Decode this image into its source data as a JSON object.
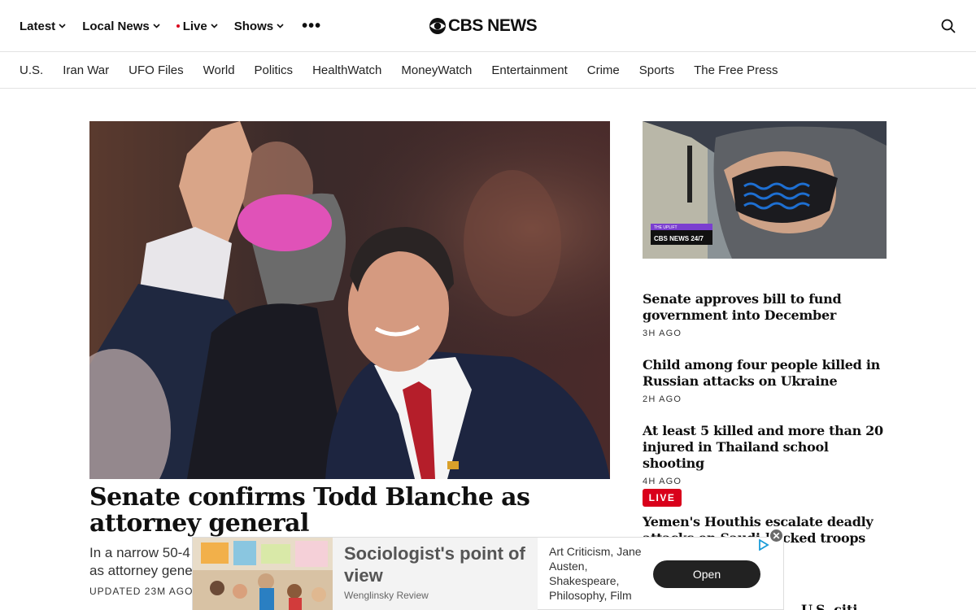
{
  "header": {
    "nav": [
      {
        "label": "Latest"
      },
      {
        "label": "Local News"
      },
      {
        "label": "Live"
      },
      {
        "label": "Shows"
      }
    ],
    "logo_text": "CBS NEWS"
  },
  "sections": [
    "U.S.",
    "Iran War",
    "UFO Files",
    "World",
    "Politics",
    "HealthWatch",
    "MoneyWatch",
    "Entertainment",
    "Crime",
    "Sports",
    "The Free Press"
  ],
  "hero": {
    "title": "Senate confirms Todd Blanche as attorney general",
    "dek_line1": "In a narrow 50-4",
    "dek_line2": "as attorney gene",
    "updated": "UPDATED 23M AGO"
  },
  "rail": {
    "image_badge_top": "THE UPLIFT",
    "image_badge_bottom": "CBS NEWS 24/7",
    "stories": [
      {
        "headline": "Senate approves bill to fund government into December",
        "time": "3H AGO"
      },
      {
        "headline": "Child among four people killed in Russian attacks on Ukraine",
        "time": "2H AGO"
      },
      {
        "headline": "At least 5 killed and more than 20 injured in Thailand school shooting",
        "time": "4H AGO"
      }
    ],
    "live_badge": "LIVE",
    "live_headline_line1": "Yemen's Houthis escalate deadly",
    "live_headline_line2": "attacks on Saudi-backed troops",
    "peek_text": "U.S. citi"
  },
  "ad": {
    "headline": "Sociologist's point of view",
    "source": "Wenglinsky Review",
    "description": "Art Criticism, Jane Austen, Shakespeare, Philosophy, Film",
    "cta": "Open"
  },
  "colors": {
    "accent_red": "#d9001b",
    "text": "#101010"
  }
}
